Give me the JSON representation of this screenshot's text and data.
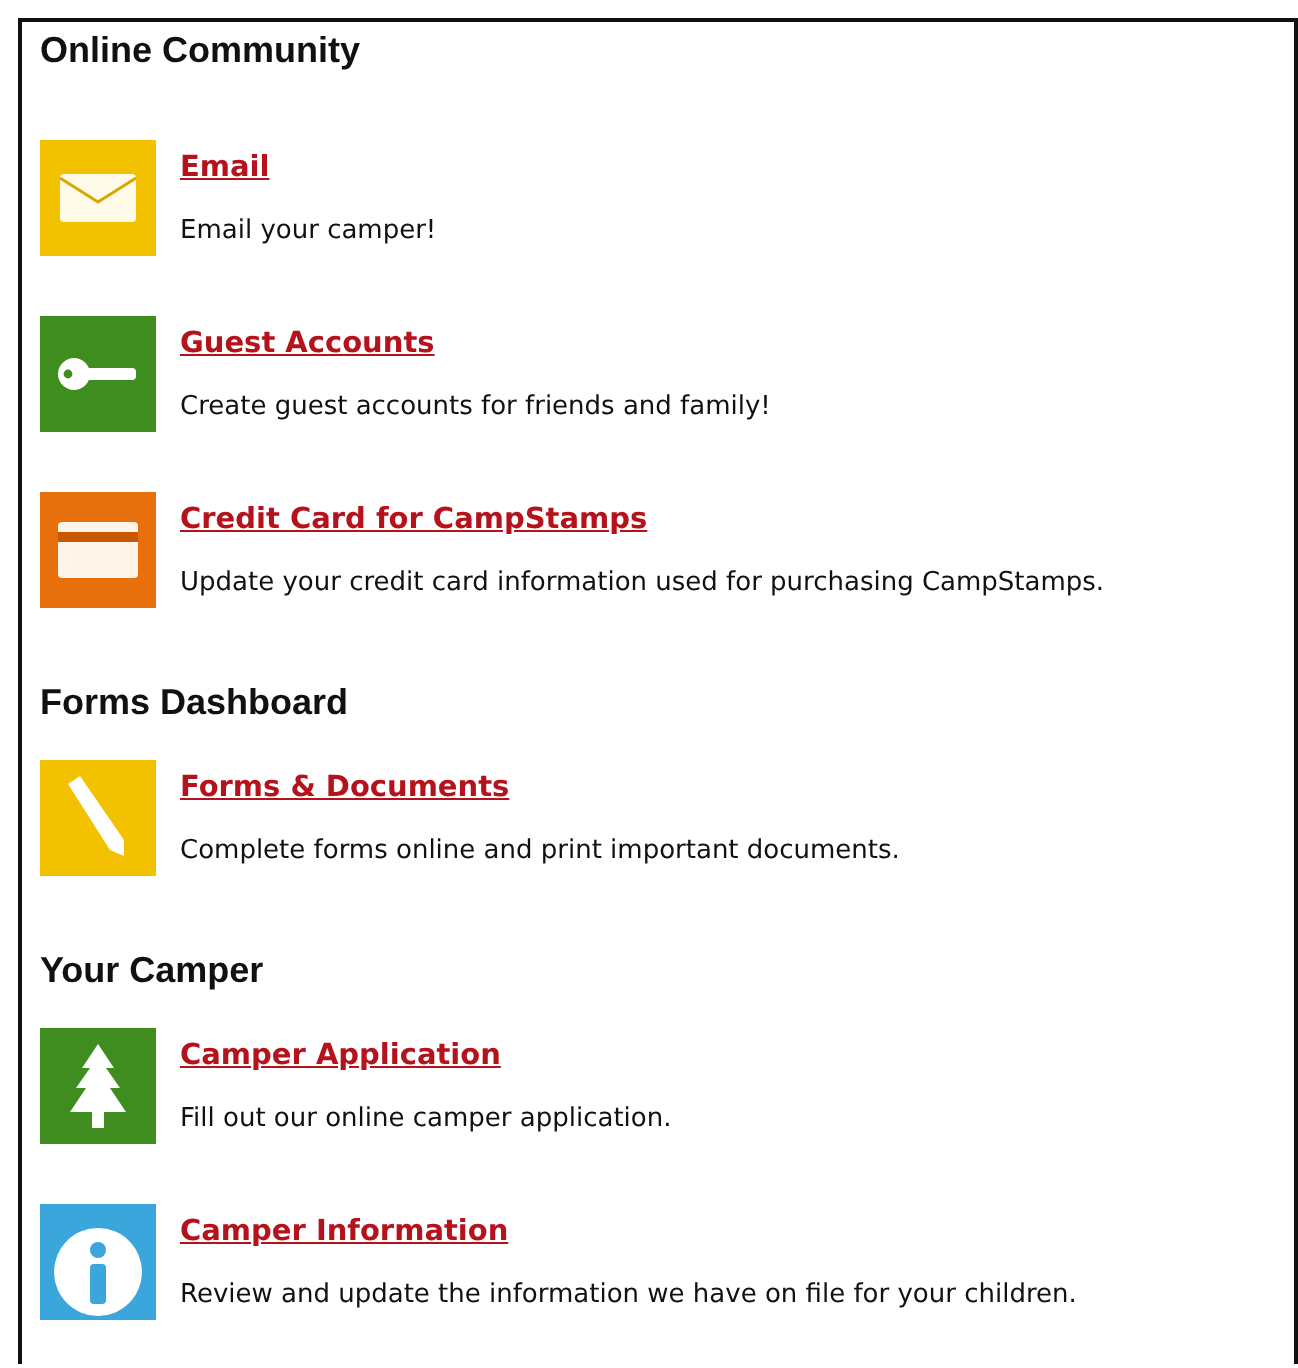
{
  "sections": [
    {
      "title": "Online Community",
      "items": [
        {
          "title": "Email",
          "description": "Email your camper!",
          "color": "#f2c200"
        },
        {
          "title": "Guest Accounts",
          "description": "Create guest accounts for friends and family!",
          "color": "#3f8c1f"
        },
        {
          "title": "Credit Card for CampStamps",
          "description": "Update your credit card information used for purchasing CampStamps.",
          "color": "#e8700c"
        }
      ]
    },
    {
      "title": "Forms Dashboard",
      "items": [
        {
          "title": "Forms & Documents",
          "description": "Complete forms online and print important documents.",
          "color": "#f2c200"
        }
      ]
    },
    {
      "title": "Your Camper",
      "items": [
        {
          "title": "Camper Application",
          "description": "Fill out our online camper application.",
          "color": "#3f8c1f"
        },
        {
          "title": "Camper Information",
          "description": "Review and update the information we have on file for your children.",
          "color": "#3aa6dc"
        }
      ]
    }
  ]
}
